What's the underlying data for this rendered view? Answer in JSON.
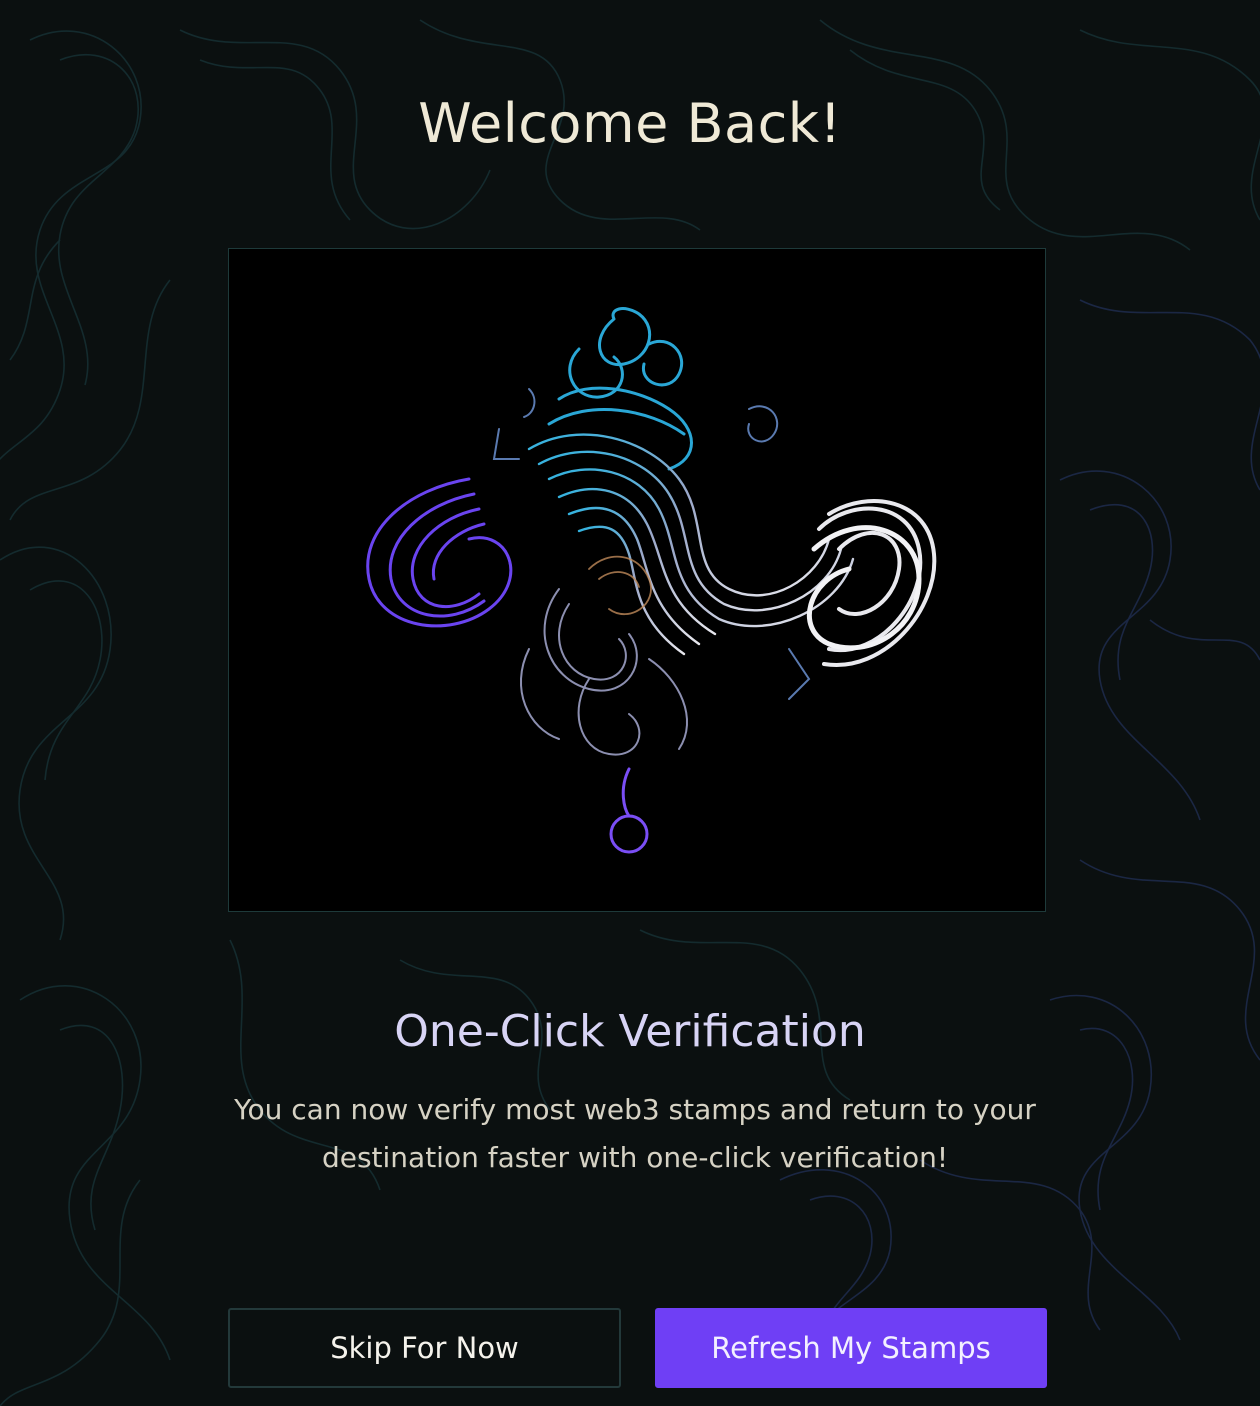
{
  "screen": {
    "title": "Welcome Back!",
    "feature_title": "One-Click Verification",
    "feature_description": "You can now verify most web3 stamps and return to your destination faster with one-click verification!"
  },
  "actions": {
    "skip_label": "Skip For Now",
    "refresh_label": "Refresh My Stamps"
  },
  "illustration": {
    "icon": "abstract-swirl-artwork"
  },
  "colors": {
    "background": "#0b1010",
    "accent": "#6f3ff5",
    "title": "#efe9d6",
    "subtitle": "#d8d4f5"
  }
}
